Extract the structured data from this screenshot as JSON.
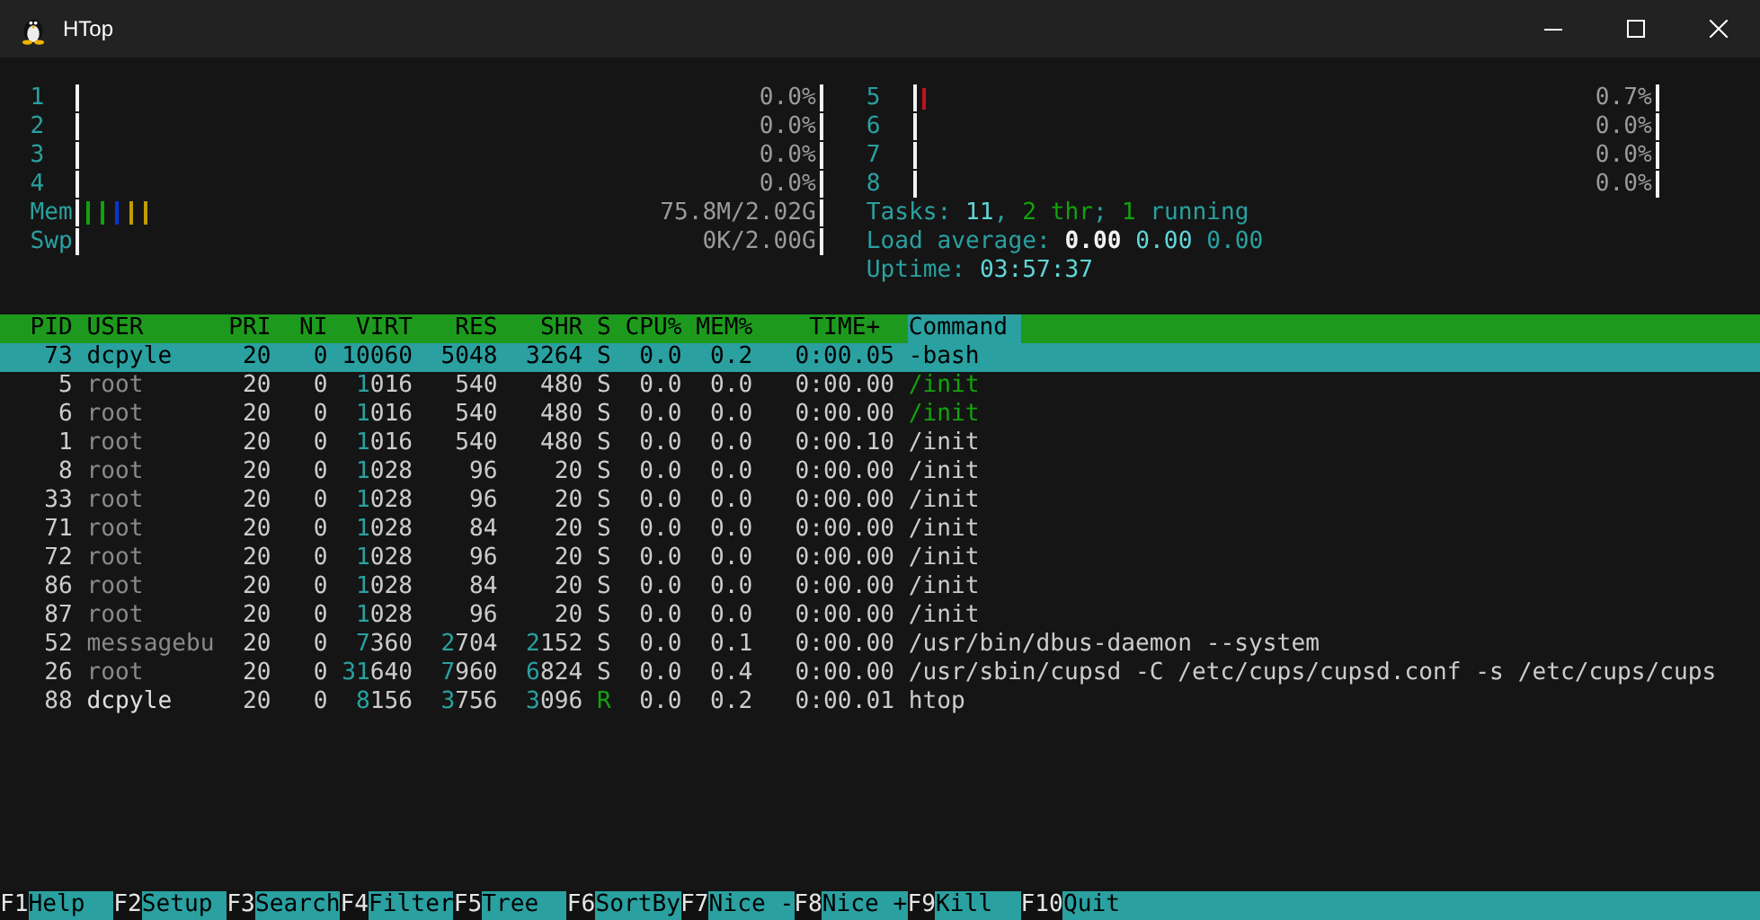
{
  "window": {
    "title": "HTop"
  },
  "cpu_meters": [
    {
      "label": "1",
      "reading": "0.0%"
    },
    {
      "label": "2",
      "reading": "0.0%"
    },
    {
      "label": "3",
      "reading": "0.0%"
    },
    {
      "label": "4",
      "reading": "0.0%"
    },
    {
      "label": "5",
      "level": 0.007,
      "reading": "0.7%"
    },
    {
      "label": "6",
      "reading": "0.0%"
    },
    {
      "label": "7",
      "reading": "0.0%"
    },
    {
      "label": "8",
      "reading": "0.0%"
    }
  ],
  "memory": {
    "label": "Mem",
    "segments": [
      {
        "color": "#13a10e"
      },
      {
        "color": "#13a10e"
      },
      {
        "color": "#0037da"
      },
      {
        "color": "#c19c00"
      },
      {
        "color": "#c19c00"
      }
    ],
    "reading": "75.8M/2.02G"
  },
  "swap": {
    "label": "Swp",
    "reading": "0K/2.00G"
  },
  "info_lines": [
    [
      {
        "text": "Tasks: ",
        "kind": "label"
      },
      {
        "text": "11",
        "kind": "bright"
      },
      {
        "text": ", ",
        "kind": "label"
      },
      {
        "text": "2",
        "kind": "green"
      },
      {
        "text": " thr",
        "kind": "green"
      },
      {
        "text": "; ",
        "kind": "label"
      },
      {
        "text": "1",
        "kind": "green"
      },
      {
        "text": " running",
        "kind": "label"
      }
    ],
    [
      {
        "text": "Load average: ",
        "kind": "label"
      },
      {
        "text": "0.00",
        "kind": "white"
      },
      {
        "text": " 0.00",
        "kind": "bright"
      },
      {
        "text": " 0.00",
        "kind": "label"
      }
    ],
    [
      {
        "text": "Uptime: ",
        "kind": "label"
      },
      {
        "text": "03:57:37",
        "kind": "bright"
      }
    ]
  ],
  "table": {
    "columns": [
      {
        "label": "PID",
        "selected": false
      },
      {
        "label": "USER",
        "selected": false
      },
      {
        "label": "PRI",
        "selected": false
      },
      {
        "label": "NI",
        "selected": false
      },
      {
        "label": "VIRT",
        "selected": false
      },
      {
        "label": "RES",
        "selected": false
      },
      {
        "label": "SHR",
        "selected": false
      },
      {
        "label": "S",
        "selected": false
      },
      {
        "label": "CPU%",
        "selected": false
      },
      {
        "label": "MEM%",
        "selected": false
      },
      {
        "label": "TIME+",
        "selected": false
      },
      {
        "label": "Command",
        "selected": true
      }
    ],
    "rows": [
      {
        "cells": [
          "73",
          "dcpyle",
          "20",
          "0",
          "10060",
          "5048",
          "3264",
          "S",
          "0.0",
          "0.2",
          "0:00.05",
          "-bash"
        ],
        "selected": true,
        "own_user": true,
        "thread": false,
        "running": false
      },
      {
        "cells": [
          "5",
          "root",
          "20",
          "0",
          "1016",
          "540",
          "480",
          "S",
          "0.0",
          "0.0",
          "0:00.00",
          "/init"
        ],
        "selected": false,
        "own_user": false,
        "thread": true,
        "running": false
      },
      {
        "cells": [
          "6",
          "root",
          "20",
          "0",
          "1016",
          "540",
          "480",
          "S",
          "0.0",
          "0.0",
          "0:00.00",
          "/init"
        ],
        "selected": false,
        "own_user": false,
        "thread": true,
        "running": false
      },
      {
        "cells": [
          "1",
          "root",
          "20",
          "0",
          "1016",
          "540",
          "480",
          "S",
          "0.0",
          "0.0",
          "0:00.10",
          "/init"
        ],
        "selected": false,
        "own_user": false,
        "thread": false,
        "running": false
      },
      {
        "cells": [
          "8",
          "root",
          "20",
          "0",
          "1028",
          "96",
          "20",
          "S",
          "0.0",
          "0.0",
          "0:00.00",
          "/init"
        ],
        "selected": false,
        "own_user": false,
        "thread": false,
        "running": false
      },
      {
        "cells": [
          "33",
          "root",
          "20",
          "0",
          "1028",
          "96",
          "20",
          "S",
          "0.0",
          "0.0",
          "0:00.00",
          "/init"
        ],
        "selected": false,
        "own_user": false,
        "thread": false,
        "running": false
      },
      {
        "cells": [
          "71",
          "root",
          "20",
          "0",
          "1028",
          "84",
          "20",
          "S",
          "0.0",
          "0.0",
          "0:00.00",
          "/init"
        ],
        "selected": false,
        "own_user": false,
        "thread": false,
        "running": false
      },
      {
        "cells": [
          "72",
          "root",
          "20",
          "0",
          "1028",
          "96",
          "20",
          "S",
          "0.0",
          "0.0",
          "0:00.00",
          "/init"
        ],
        "selected": false,
        "own_user": false,
        "thread": false,
        "running": false
      },
      {
        "cells": [
          "86",
          "root",
          "20",
          "0",
          "1028",
          "84",
          "20",
          "S",
          "0.0",
          "0.0",
          "0:00.00",
          "/init"
        ],
        "selected": false,
        "own_user": false,
        "thread": false,
        "running": false
      },
      {
        "cells": [
          "87",
          "root",
          "20",
          "0",
          "1028",
          "96",
          "20",
          "S",
          "0.0",
          "0.0",
          "0:00.00",
          "/init"
        ],
        "selected": false,
        "own_user": false,
        "thread": false,
        "running": false
      },
      {
        "cells": [
          "52",
          "messagebu",
          "20",
          "0",
          "7360",
          "2704",
          "2152",
          "S",
          "0.0",
          "0.1",
          "0:00.00",
          "/usr/bin/dbus-daemon --system"
        ],
        "selected": false,
        "own_user": false,
        "thread": false,
        "running": false
      },
      {
        "cells": [
          "26",
          "root",
          "20",
          "0",
          "31640",
          "7960",
          "6824",
          "S",
          "0.0",
          "0.4",
          "0:00.00",
          "/usr/sbin/cupsd -C /etc/cups/cupsd.conf -s /etc/cups/cups"
        ],
        "selected": false,
        "own_user": false,
        "thread": false,
        "running": false
      },
      {
        "cells": [
          "88",
          "dcpyle",
          "20",
          "0",
          "8156",
          "3756",
          "3096",
          "R",
          "0.0",
          "0.2",
          "0:00.01",
          "htop"
        ],
        "selected": false,
        "own_user": true,
        "thread": false,
        "running": true
      }
    ]
  },
  "function_keys": [
    {
      "key": "F1",
      "label": "Help"
    },
    {
      "key": "F2",
      "label": "Setup"
    },
    {
      "key": "F3",
      "label": "Search"
    },
    {
      "key": "F4",
      "label": "Filter"
    },
    {
      "key": "F5",
      "label": "Tree"
    },
    {
      "key": "F6",
      "label": "SortBy"
    },
    {
      "key": "F7",
      "label": "Nice -"
    },
    {
      "key": "F8",
      "label": "Nice +"
    },
    {
      "key": "F9",
      "label": "Kill"
    },
    {
      "key": "F10",
      "label": "Quit"
    }
  ]
}
